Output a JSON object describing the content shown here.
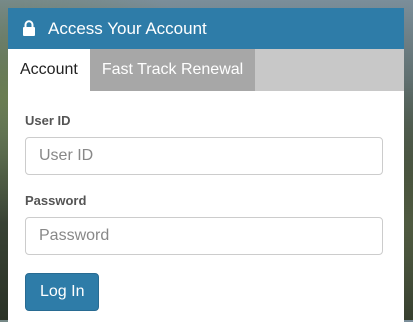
{
  "header": {
    "title": "Access Your Account",
    "icon": "lock-icon"
  },
  "tabs": [
    {
      "label": "Account",
      "active": true
    },
    {
      "label": "Fast Track Renewal",
      "active": false
    }
  ],
  "form": {
    "user_id_label": "User ID",
    "user_id_placeholder": "User ID",
    "user_id_value": "",
    "password_label": "Password",
    "password_placeholder": "Password",
    "password_value": "",
    "submit_label": "Log In"
  },
  "colors": {
    "accent": "#2e7ca8",
    "tab_inactive": "#a7a7a7",
    "tab_bar": "#c8c8c8"
  }
}
